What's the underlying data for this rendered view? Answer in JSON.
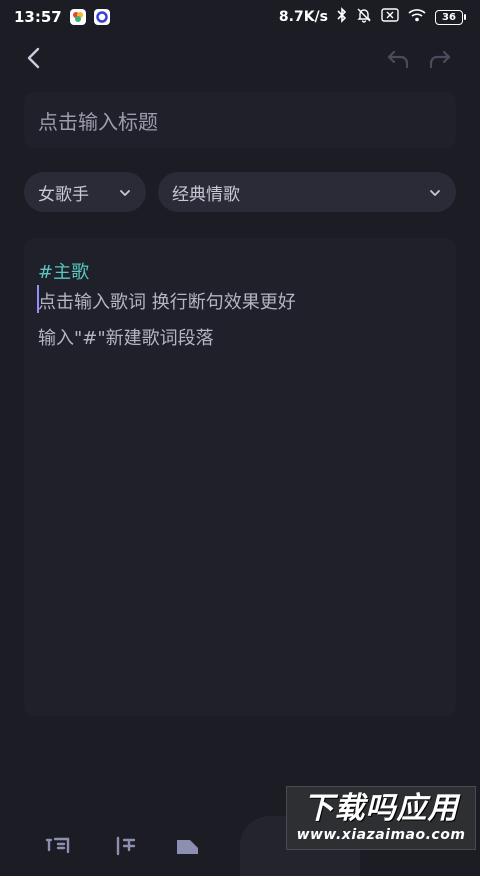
{
  "status_bar": {
    "time": "13:57",
    "net_speed": "8.7K/s",
    "battery": "36",
    "icons": [
      "app-icon-1",
      "app-icon-2",
      "bluetooth-icon",
      "bell-muted-icon",
      "sim-off-icon",
      "wifi-icon",
      "battery-icon"
    ]
  },
  "nav": {
    "icons": [
      "back-arrow-icon",
      "undo-icon",
      "redo-icon"
    ]
  },
  "title_field": {
    "placeholder": "点击输入标题"
  },
  "selectors": {
    "singer": "女歌手",
    "style": "经典情歌"
  },
  "editor": {
    "section_tag": "#主歌",
    "lyric_hint": "点击输入歌词 换行断句效果更好",
    "section_hint": "输入\"#\"新建歌词段落"
  },
  "bottom_toolbar": {
    "icons": [
      "word-icon",
      "line-break-icon",
      "tag-icon"
    ]
  },
  "watermark": {
    "title": "下载吗应用",
    "url": "www.xiazaimao.com"
  },
  "colors": {
    "background": "#1b1c24",
    "panel": "#1f2029",
    "pill": "#2a2b36",
    "section_tag": "#58c7c0",
    "cursor": "#8f90ff"
  }
}
